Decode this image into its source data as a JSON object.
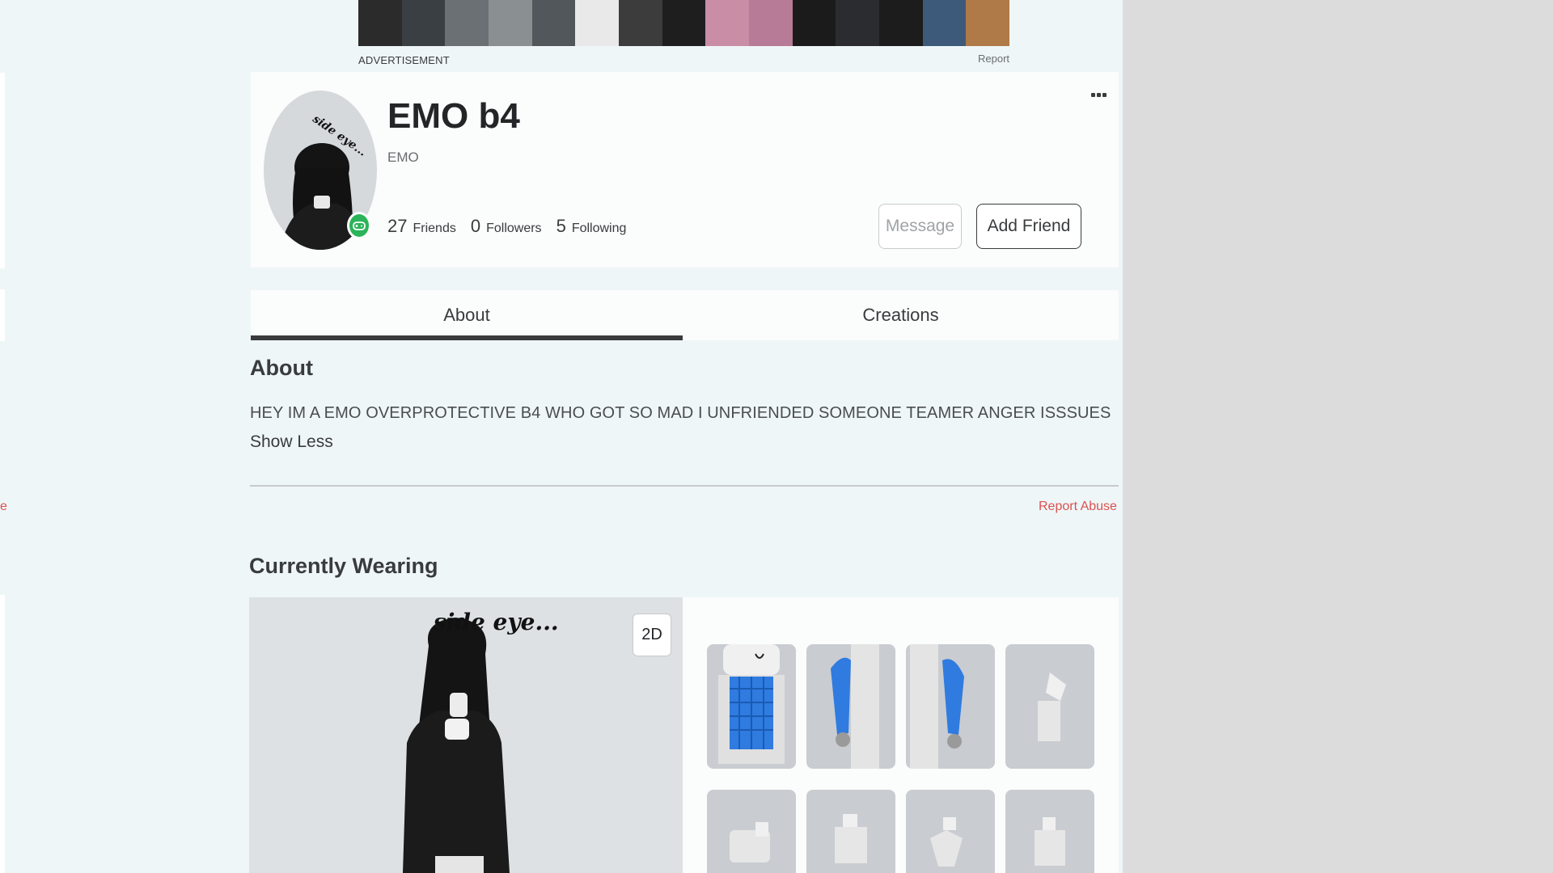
{
  "ad": {
    "label": "ADVERTISEMENT",
    "report": "Report",
    "colors": [
      "#2b2b2b",
      "#3a3f44",
      "#6b7075",
      "#8a8f92",
      "#52575b",
      "#e9e9e9",
      "#3c3c3c",
      "#1e1e1e",
      "#c98ea6",
      "#b77b97",
      "#1b1b1b",
      "#2a2c30",
      "#1c1c1c",
      "#3e5a7a",
      "#b07a48"
    ]
  },
  "profile": {
    "display_name": "EMO b4",
    "username": "EMO",
    "avatar_caption": "side eye...",
    "stats": [
      {
        "value": "27",
        "label": "Friends"
      },
      {
        "value": "0",
        "label": "Followers"
      },
      {
        "value": "5",
        "label": "Following"
      }
    ],
    "message_label": "Message",
    "add_friend_label": "Add Friend"
  },
  "tabs": [
    {
      "label": "About"
    },
    {
      "label": "Creations"
    }
  ],
  "about": {
    "title": "About",
    "text": "HEY IM A EMO OVERPROTECTIVE B4 WHO GOT SO MAD I UNFRIENDED SOMEONE TEAMER ANGER ISSSUES",
    "show_less": "Show Less",
    "report_abuse": "Report Abuse"
  },
  "wearing": {
    "title": "Currently Wearing",
    "viewer_caption": "side eye...",
    "toggle_2d": "2D",
    "items": [
      "torso-shirt",
      "left-arm",
      "right-arm",
      "body-part",
      "body-part",
      "body-part",
      "body-part",
      "body-part"
    ]
  },
  "colors": {
    "accent_green": "#2bb459",
    "report_red": "#d9534f",
    "shirt_blue": "#2f7be0"
  }
}
